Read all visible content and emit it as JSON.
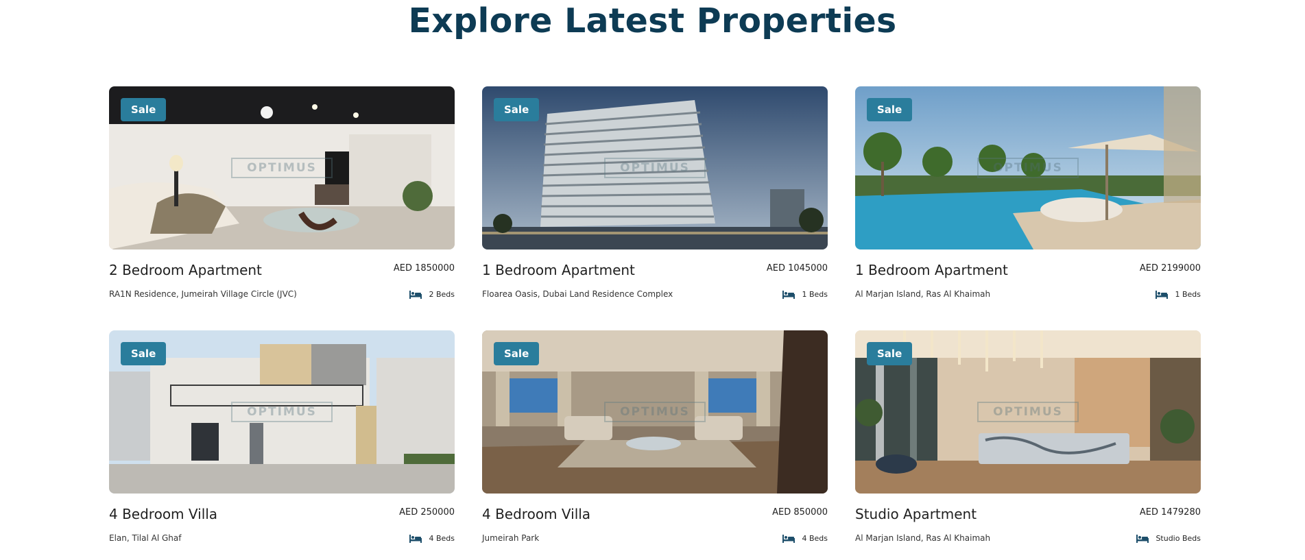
{
  "section": {
    "title": "Explore Latest Properties"
  },
  "colors": {
    "title": "#0d3b54",
    "badge": "#2a7d9c",
    "bed_icon": "#1e4f6b"
  },
  "properties": [
    {
      "badge": "Sale",
      "title": "2 Bedroom Apartment",
      "price": "AED 1850000",
      "location": "RA1N Residence, Jumeirah Village Circle (JVC)",
      "beds": "2 Beds",
      "icon": "bed-icon",
      "watermark": "OPTIMUS",
      "scene": "living-room"
    },
    {
      "badge": "Sale",
      "title": "1 Bedroom Apartment",
      "price": "AED 1045000",
      "location": "Floarea Oasis, Dubai Land Residence Complex",
      "beds": "1 Beds",
      "icon": "bed-icon",
      "watermark": "OPTIMUS",
      "scene": "tower"
    },
    {
      "badge": "Sale",
      "title": "1 Bedroom Apartment",
      "price": "AED 2199000",
      "location": "Al Marjan Island, Ras Al Khaimah",
      "beds": "1 Beds",
      "icon": "bed-icon",
      "watermark": "OPTIMUS",
      "scene": "pool"
    },
    {
      "badge": "Sale",
      "title": "4 Bedroom Villa",
      "price": "AED 250000",
      "location": "Elan, Tilal Al Ghaf",
      "beds": "4 Beds",
      "icon": "bed-icon",
      "watermark": "OPTIMUS",
      "scene": "villa"
    },
    {
      "badge": "Sale",
      "title": "4 Bedroom Villa",
      "price": "AED 850000",
      "location": "Jumeirah Park",
      "beds": "4 Beds",
      "icon": "bed-icon",
      "watermark": "OPTIMUS",
      "scene": "majlis"
    },
    {
      "badge": "Sale",
      "title": "Studio Apartment",
      "price": "AED 1479280",
      "location": "Al Marjan Island, Ras Al Khaimah",
      "beds": "Studio Beds",
      "icon": "bed-icon",
      "watermark": "OPTIMUS",
      "scene": "lobby"
    }
  ]
}
